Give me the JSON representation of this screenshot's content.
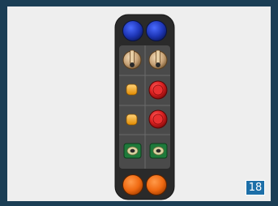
{
  "page_number": "18",
  "colors": {
    "frame_border": "#1b3e55",
    "background": "#eeeeee",
    "console_body": "#2a2a2a",
    "slot_bg": "#4a4a4a",
    "blue_cap": "#1f37b8",
    "tan_knob": "#c7a277",
    "amber_knob": "#f3a81c",
    "red_knob": "#d91f1f",
    "green_switch": "#1e7a3b",
    "orange_cap": "#f06a12",
    "badge_bg": "#1d6fa8"
  },
  "controls": [
    {
      "row": "top",
      "left": "blue-cap",
      "right": "blue-cap"
    },
    {
      "row": "dial",
      "left": "tan-dial",
      "right": "tan-dial"
    },
    {
      "row": "knob-1",
      "left": "amber-knob",
      "right": "red-knob"
    },
    {
      "row": "knob-2",
      "left": "amber-knob",
      "right": "red-knob"
    },
    {
      "row": "switch",
      "left": "green-switch",
      "right": "green-switch"
    },
    {
      "row": "bottom",
      "left": "orange-cap",
      "right": "orange-cap"
    }
  ]
}
